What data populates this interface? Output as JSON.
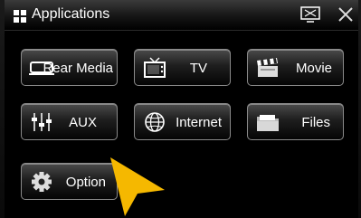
{
  "window": {
    "title": "Applications"
  },
  "icons": {
    "grid": "apps-grid-icon",
    "screen": "screen-toggle-icon",
    "close": "close-icon"
  },
  "tiles": [
    {
      "label": "Rear Media",
      "icon": "rear-media-icon"
    },
    {
      "label": "TV",
      "icon": "tv-icon"
    },
    {
      "label": "Movie",
      "icon": "movie-clapper-icon"
    },
    {
      "label": "AUX",
      "icon": "aux-sliders-icon"
    },
    {
      "label": "Internet",
      "icon": "globe-icon"
    },
    {
      "label": "Files",
      "icon": "folder-icon"
    },
    {
      "label": "Option",
      "icon": "gear-icon"
    }
  ],
  "colors": {
    "accent_pointer": "#f5b800",
    "background": "#000000"
  }
}
